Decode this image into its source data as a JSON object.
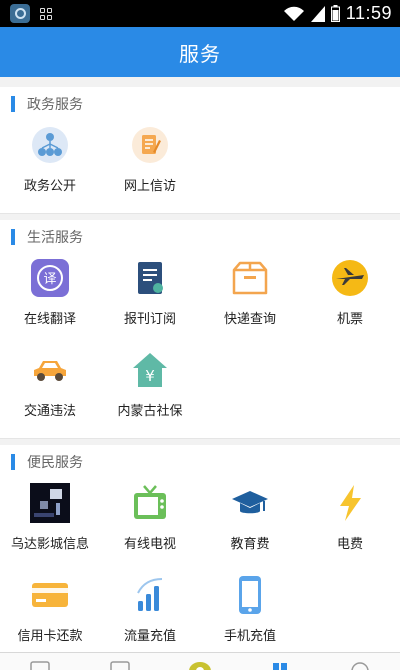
{
  "status_bar": {
    "time": "11:59",
    "icons": [
      "app-icon",
      "grid-icon",
      "wifi-icon",
      "signal-icon",
      "battery-icon"
    ]
  },
  "header": {
    "title": "服务"
  },
  "sections": [
    {
      "title": "政务服务",
      "items": [
        {
          "label": "政务公开",
          "icon": "org-chart-icon"
        },
        {
          "label": "网上信访",
          "icon": "document-edit-icon"
        }
      ]
    },
    {
      "title": "生活服务",
      "items": [
        {
          "label": "在线翻译",
          "icon": "translate-icon"
        },
        {
          "label": "报刊订阅",
          "icon": "newspaper-icon"
        },
        {
          "label": "快递查询",
          "icon": "package-icon"
        },
        {
          "label": "机票",
          "icon": "airplane-icon"
        },
        {
          "label": "交通违法",
          "icon": "car-icon"
        },
        {
          "label": "内蒙古社保",
          "icon": "social-security-icon"
        }
      ]
    },
    {
      "title": "便民服务",
      "items": [
        {
          "label": "乌达影城信息",
          "icon": "cinema-photo-icon"
        },
        {
          "label": "有线电视",
          "icon": "tv-icon"
        },
        {
          "label": "教育费",
          "icon": "graduation-cap-icon"
        },
        {
          "label": "电费",
          "icon": "lightning-icon"
        },
        {
          "label": "信用卡还款",
          "icon": "credit-card-icon"
        },
        {
          "label": "流量充值",
          "icon": "signal-bars-icon"
        },
        {
          "label": "手机充值",
          "icon": "phone-icon"
        }
      ]
    }
  ],
  "colors": {
    "accent": "#2a8ae6",
    "header_text": "#ffffff",
    "section_title": "#666666"
  }
}
